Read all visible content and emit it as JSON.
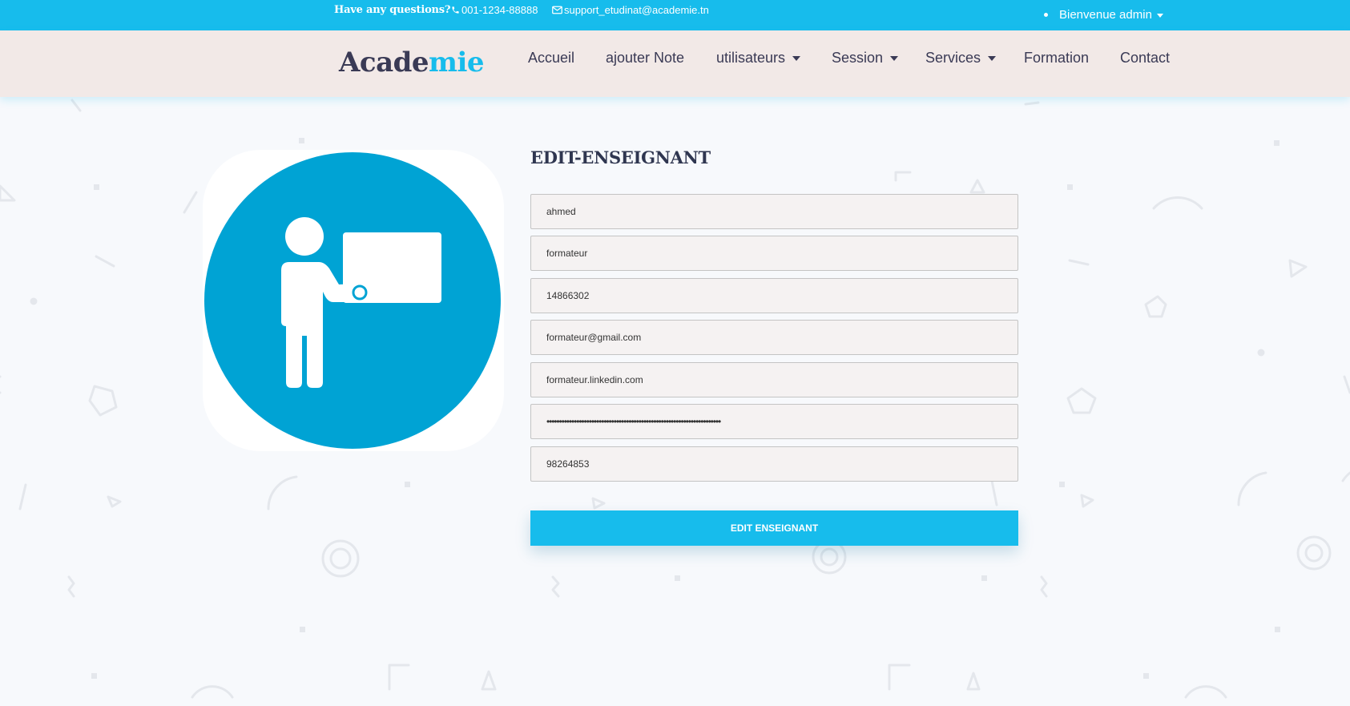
{
  "topbar": {
    "questions": "Have any questions?",
    "phone": "001-1234-88888",
    "email": "support_etudinat@academie.tn",
    "welcome": "Bienvenue admin"
  },
  "brand": {
    "part1": "Acade",
    "part2": "mie"
  },
  "nav": [
    {
      "label": "Accueil",
      "dropdown": false
    },
    {
      "label": "ajouter Note",
      "dropdown": false
    },
    {
      "label": "utilisateurs",
      "dropdown": true
    },
    {
      "label": "Session",
      "dropdown": true
    },
    {
      "label": "Services",
      "dropdown": true
    },
    {
      "label": "Formation",
      "dropdown": false
    },
    {
      "label": "Contact",
      "dropdown": false
    }
  ],
  "form": {
    "title": "EDIT-ENSEIGNANT",
    "fields": {
      "nom": "ahmed",
      "prenom": "formateur",
      "cin": "14866302",
      "email": "formateur@gmail.com",
      "linkedin": "formateur.linkedin.com",
      "password": "••••••••••••••••••••••••••••••••••••••••••••••••••••••••••••••••••••••",
      "telephone": "98264853"
    },
    "submit": "EDIT ENSEIGNANT"
  },
  "colors": {
    "accent": "#17bcec",
    "illustration_circle": "#00a3d4",
    "navbar_bg": "#f2e9e7",
    "text_dark": "#3a3a55"
  },
  "icons": [
    "phone-icon",
    "envelope-icon",
    "teacher-board-icon"
  ]
}
